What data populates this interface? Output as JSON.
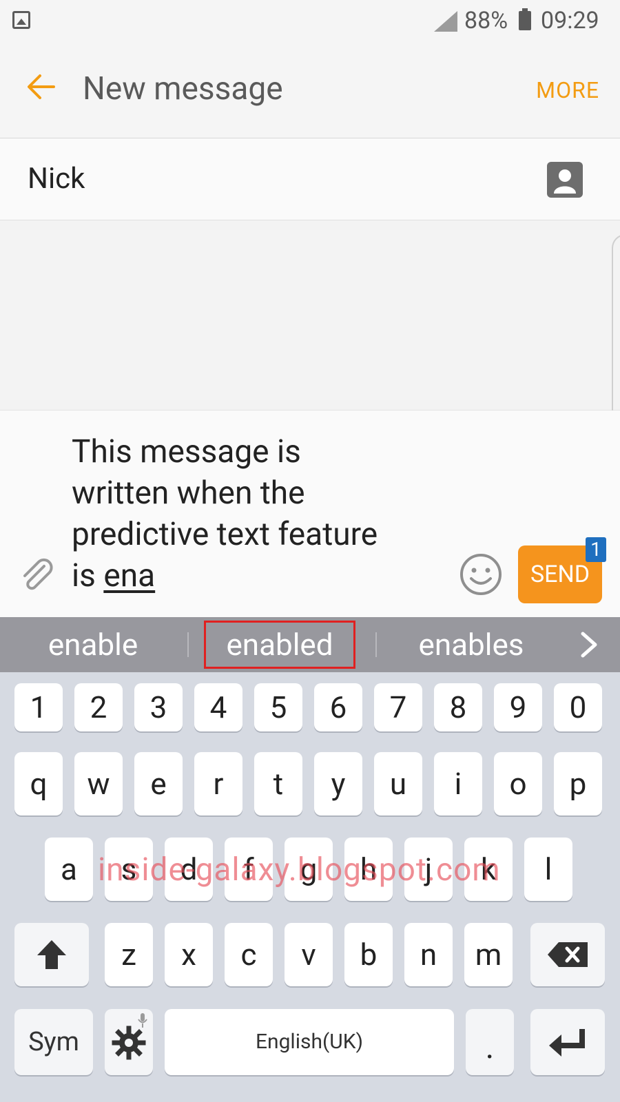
{
  "status": {
    "battery": "88%",
    "time": "09:29"
  },
  "appbar": {
    "title": "New message",
    "more": "MORE"
  },
  "recipient": {
    "name": "Nick"
  },
  "composer": {
    "lines": [
      "This message is",
      "written when the",
      "predictive text feature",
      "is "
    ],
    "typed": "ena",
    "send": "SEND",
    "badge": "1"
  },
  "suggestions": [
    "enable",
    "enabled",
    "enables"
  ],
  "keyboard": {
    "numbers": [
      "1",
      "2",
      "3",
      "4",
      "5",
      "6",
      "7",
      "8",
      "9",
      "0"
    ],
    "row1": [
      "q",
      "w",
      "e",
      "r",
      "t",
      "y",
      "u",
      "i",
      "o",
      "p"
    ],
    "row2": [
      "a",
      "s",
      "d",
      "f",
      "g",
      "h",
      "j",
      "k",
      "l"
    ],
    "row3": [
      "z",
      "x",
      "c",
      "v",
      "b",
      "n",
      "m"
    ],
    "sym": "Sym",
    "space": "English(UK)",
    "period": "."
  },
  "watermark": "inside-galaxy.blogspot.com",
  "colors": {
    "accent": "#f39c12",
    "send": "#f5941d",
    "badge": "#1f6fbf",
    "highlight": "#e02020"
  }
}
